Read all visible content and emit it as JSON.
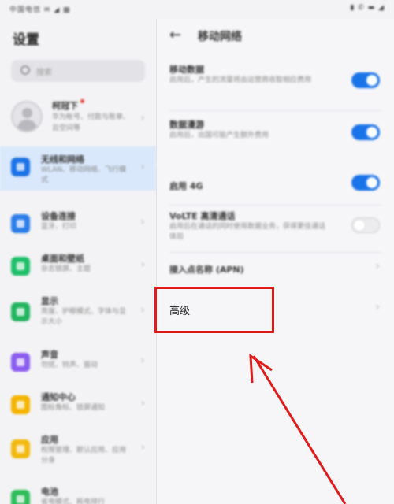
{
  "status_bar": {
    "left_text": "中国电信 ✉ ◢ ▦",
    "right_text": "▮ ✆ ▬ ◢"
  },
  "left_pane": {
    "title": "设置",
    "search_placeholder": "搜索",
    "profile": {
      "name": "柯冠下",
      "subtitle": "华为帐号、付款与账单、云空间等"
    },
    "items": [
      {
        "title": "无线和网络",
        "subtitle": "WLAN、移动网络、飞行模式",
        "icon": "wireless-network-icon",
        "color": "#1a73e8"
      },
      {
        "title": "设备连接",
        "subtitle": "蓝牙、打印",
        "icon": "device-connection-icon",
        "color": "#2b7de9"
      },
      {
        "title": "桌面和壁纸",
        "subtitle": "杂志锁屏、主题",
        "icon": "home-wallpaper-icon",
        "color": "#1fbf6a"
      },
      {
        "title": "显示",
        "subtitle": "亮度、护眼模式、字体与显示大小",
        "icon": "display-icon",
        "color": "#22b55f"
      },
      {
        "title": "声音",
        "subtitle": "勿扰、铃声、振动",
        "icon": "sound-icon",
        "color": "#8a5cf0"
      },
      {
        "title": "通知中心",
        "subtitle": "图标角标、锁屏通知",
        "icon": "notification-icon",
        "color": "#f4b400"
      },
      {
        "title": "应用",
        "subtitle": "权限管理、默认应用、应用分身",
        "icon": "apps-icon",
        "color": "#f2b90f"
      },
      {
        "title": "电池",
        "subtitle": "省电模式、耗电排行",
        "icon": "battery-icon",
        "color": "#2ebd59"
      }
    ]
  },
  "right_pane": {
    "title": "移动网络",
    "rows": [
      {
        "title": "移动数据",
        "subtitle": "启用后，产生的流量将由运营商收取相应费用",
        "toggle": "on"
      },
      {
        "title": "数据漫游",
        "subtitle": "启用后，出国可能产生额外费用",
        "toggle": "on"
      },
      {
        "title": "启用 4G",
        "subtitle": "",
        "toggle": "on"
      },
      {
        "title": "VoLTE 高清通话",
        "subtitle": "启用后在通话的同时使用数据业务，获得更佳通话体验",
        "toggle": "off"
      },
      {
        "title": "接入点名称 (APN)",
        "subtitle": "",
        "toggle": "none"
      }
    ],
    "advanced_label": "高级"
  },
  "colors": {
    "accent": "#1a73e8",
    "highlight": "#e21a1a"
  }
}
